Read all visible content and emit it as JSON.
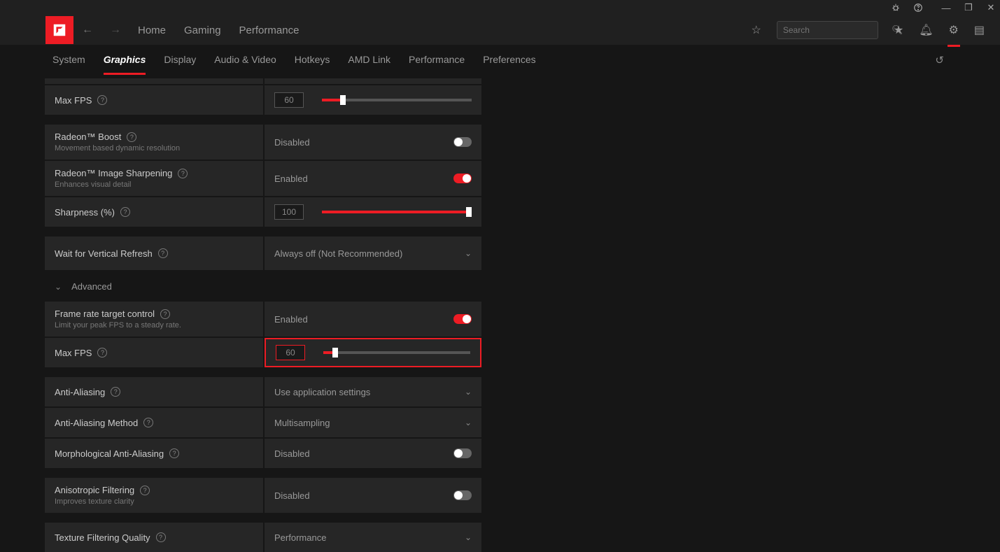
{
  "titlebar": {
    "bug": "🐞",
    "help": "?",
    "min": "—",
    "max": "❐",
    "close": "✕"
  },
  "header": {
    "nav": [
      "Home",
      "Gaming",
      "Performance"
    ],
    "search_placeholder": "Search"
  },
  "subnav": [
    "System",
    "Graphics",
    "Display",
    "Audio & Video",
    "Hotkeys",
    "AMD Link",
    "Performance",
    "Preferences"
  ],
  "subnav_active": 1,
  "rows": {
    "maxfps1": {
      "label": "Max FPS",
      "value": "60",
      "percent": 12
    },
    "boost": {
      "label": "Radeon™ Boost",
      "sub": "Movement based dynamic resolution",
      "value": "Disabled",
      "on": false
    },
    "sharpen": {
      "label": "Radeon™ Image Sharpening",
      "sub": "Enhances visual detail",
      "value": "Enabled",
      "on": true
    },
    "sharpness": {
      "label": "Sharpness (%)",
      "value": "100",
      "percent": 100
    },
    "vsync": {
      "label": "Wait for Vertical Refresh",
      "value": "Always off (Not Recommended)"
    },
    "advanced": "Advanced",
    "frtc": {
      "label": "Frame rate target control",
      "sub": "Limit your peak FPS to a steady rate.",
      "value": "Enabled",
      "on": true
    },
    "maxfps2": {
      "label": "Max FPS",
      "value": "60",
      "percent": 6
    },
    "aa": {
      "label": "Anti-Aliasing",
      "value": "Use application settings"
    },
    "aamethod": {
      "label": "Anti-Aliasing Method",
      "value": "Multisampling"
    },
    "morphaa": {
      "label": "Morphological Anti-Aliasing",
      "value": "Disabled",
      "on": false
    },
    "aniso": {
      "label": "Anisotropic Filtering",
      "sub": "Improves texture clarity",
      "value": "Disabled",
      "on": false
    },
    "texfilt": {
      "label": "Texture Filtering Quality",
      "value": "Performance"
    }
  }
}
